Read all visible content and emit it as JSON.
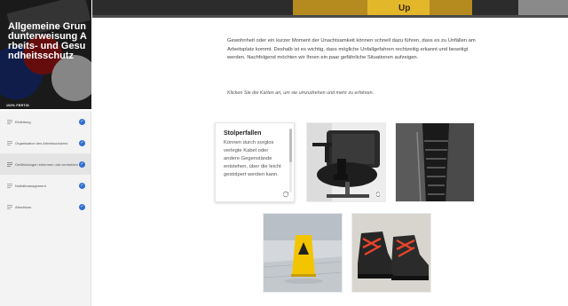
{
  "sidebar": {
    "title": "Allgemeine Grundunterweisung Arbeits- und Gesundheitsschutz",
    "progress_label": "100% FERTIG",
    "progress_value": 1.0,
    "items": [
      {
        "label": "Einleitung",
        "completed": true,
        "active": false
      },
      {
        "label": "Organisation des Arbeitsschutzes",
        "completed": true,
        "active": false
      },
      {
        "label": "Gefährdungen erkennen und vermeiden",
        "completed": true,
        "active": true
      },
      {
        "label": "Notfallmanagement",
        "completed": true,
        "active": false
      },
      {
        "label": "Abschluss",
        "completed": true,
        "active": false
      }
    ]
  },
  "banner": {
    "text": "Up"
  },
  "content": {
    "intro": "Gewohnheit oder ein kurzer Moment der Unachtsamkeit können schnell dazu führen, dass es zu Unfällen am Arbeitsplatz kommt. Deshalb ist es wichtig, dass mögliche Unfallgefahren rechtzeitig erkannt und beseitigt werden. Nachfolgend möchten wir Ihnen ein paar gefährliche Situationen aufzeigen.",
    "hint": "Klicken Sie die Karten an, um sie umzudrehen und mehr zu erfahren.",
    "cards": [
      {
        "title": "Stolperfallen",
        "text": "Können durch sorglos verlegte Kabel oder andere Gegenstände entstehen, über die leicht gestolpert werden kann."
      }
    ]
  },
  "colors": {
    "accent": "#2f6ed1",
    "sidebar_bg": "#f3f3f3"
  },
  "icons": {
    "menu": "list-icon",
    "check": "check-icon",
    "flip": "flip-icon"
  }
}
